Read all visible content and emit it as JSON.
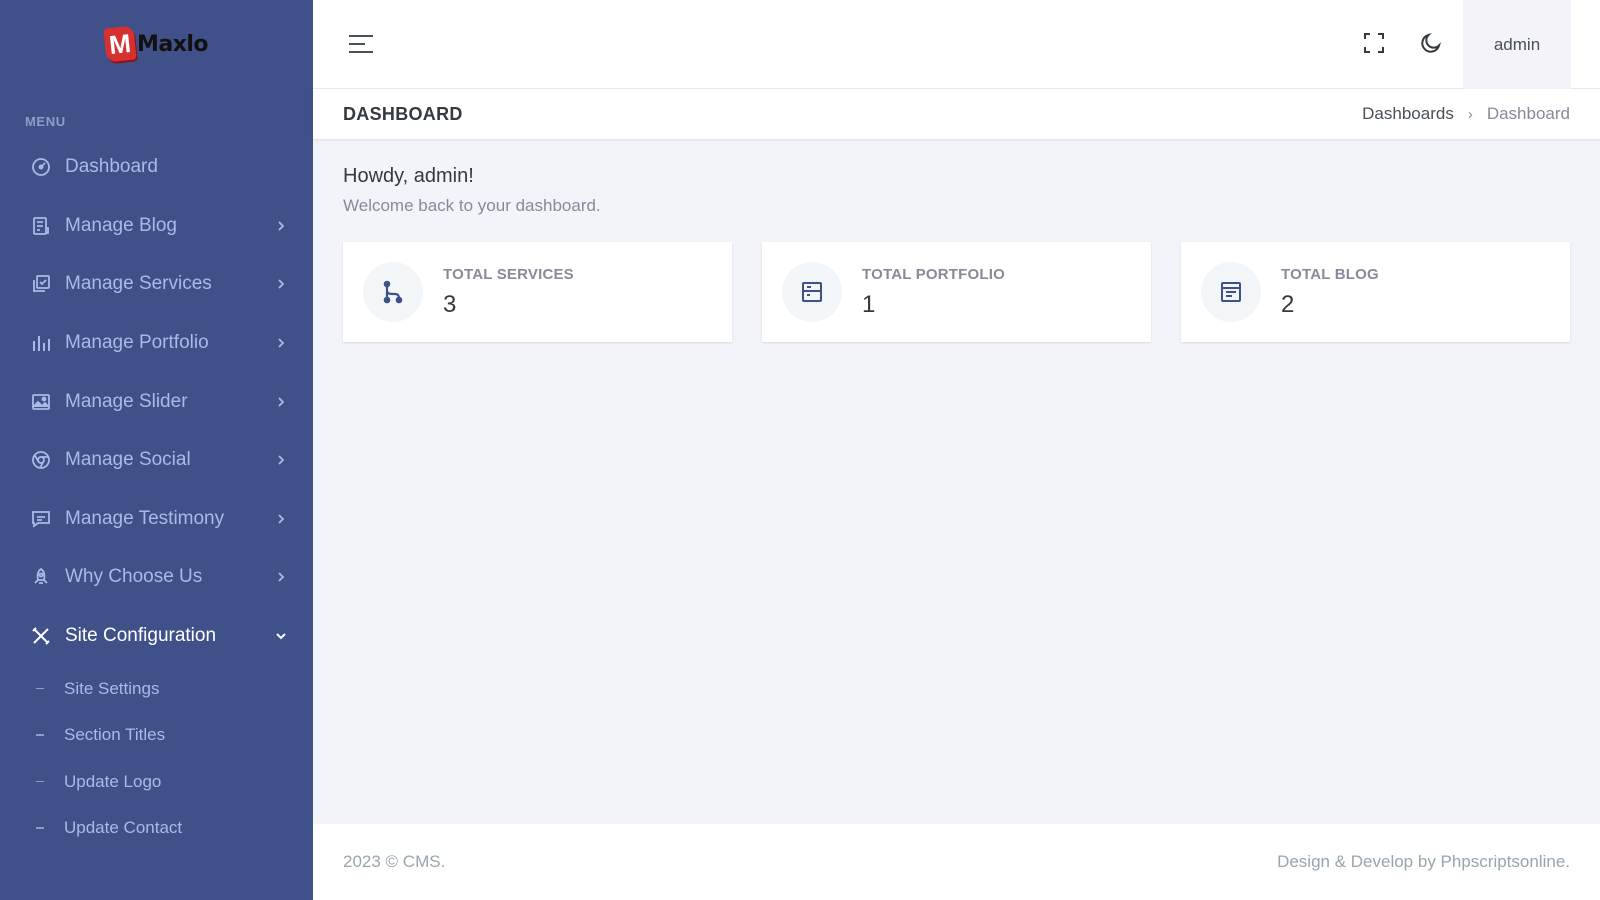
{
  "brand": {
    "name": "Maxlo",
    "mark": "M"
  },
  "sidebar": {
    "menu_title": "MENU",
    "items": [
      {
        "label": "Dashboard",
        "icon": "dashboard-icon"
      },
      {
        "label": "Manage Blog",
        "icon": "blog-icon"
      },
      {
        "label": "Manage Services",
        "icon": "services-icon"
      },
      {
        "label": "Manage Portfolio",
        "icon": "bar-chart-icon"
      },
      {
        "label": "Manage Slider",
        "icon": "image-icon"
      },
      {
        "label": "Manage Social",
        "icon": "chrome-icon"
      },
      {
        "label": "Manage Testimony",
        "icon": "message-icon"
      },
      {
        "label": "Why Choose Us",
        "icon": "rocket-icon"
      },
      {
        "label": "Site Configuration",
        "icon": "tools-icon"
      }
    ],
    "subitems": [
      {
        "label": "Site Settings"
      },
      {
        "label": "Section Titles"
      },
      {
        "label": "Update Logo"
      },
      {
        "label": "Update Contact"
      }
    ]
  },
  "topbar": {
    "user": "admin"
  },
  "titlebar": {
    "title": "DASHBOARD",
    "breadcrumb": [
      "Dashboards",
      "Dashboard"
    ]
  },
  "main": {
    "greeting": "Howdy, admin!",
    "subtitle": "Welcome back to your dashboard.",
    "cards": [
      {
        "label": "TOTAL SERVICES",
        "value": "3",
        "icon": "branch-icon"
      },
      {
        "label": "TOTAL PORTFOLIO",
        "value": "1",
        "icon": "layout-icon"
      },
      {
        "label": "TOTAL BLOG",
        "value": "2",
        "icon": "article-icon"
      }
    ]
  },
  "footer": {
    "left": "2023 © CMS.",
    "right": "Design & Develop by Phpscriptsonline."
  },
  "colors": {
    "sidebar_bg": "#405189",
    "sidebar_text": "#abb9e8",
    "page_bg": "#f3f4f9",
    "logo_red": "#d63031"
  }
}
